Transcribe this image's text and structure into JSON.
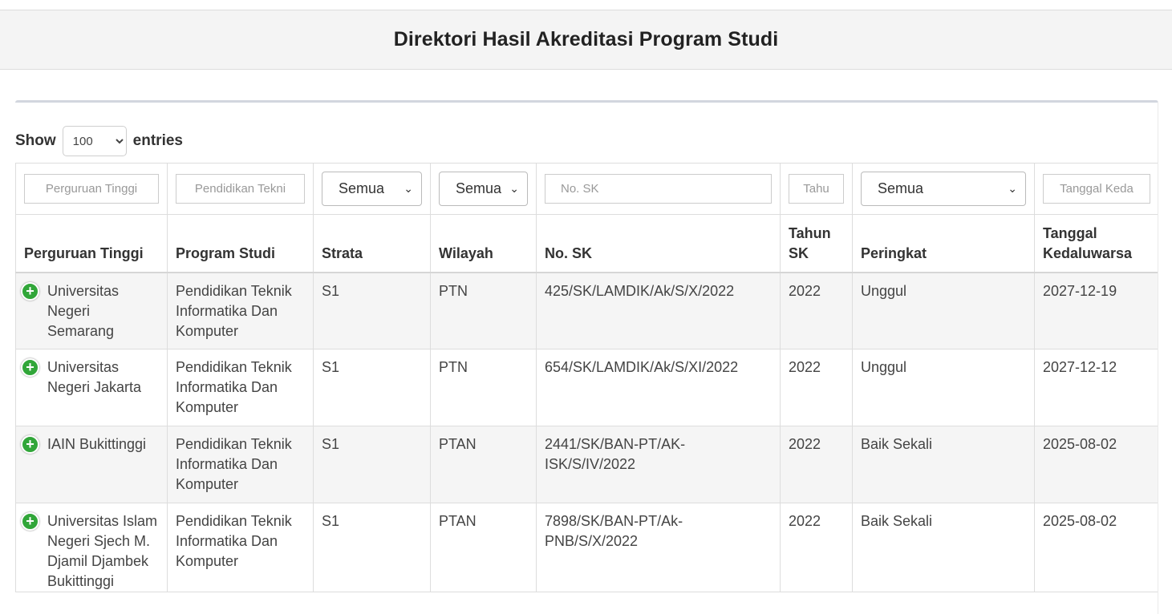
{
  "header": {
    "title": "Direktori Hasil Akreditasi Program Studi"
  },
  "length_menu": {
    "show_label": "Show",
    "selected": "100",
    "entries_label": "entries"
  },
  "filters": {
    "perguruan_tinggi_placeholder": "Perguruan Tinggi",
    "program_studi_placeholder": "Pendidikan Tekni",
    "strata_selected": "Semua",
    "wilayah_selected": "Semua",
    "no_sk_placeholder": "No. SK",
    "tahun_sk_placeholder": "Tahu",
    "peringkat_selected": "Semua",
    "tanggal_placeholder": "Tanggal Keda"
  },
  "columns": {
    "perguruan_tinggi": "Perguruan Tinggi",
    "program_studi": "Program Studi",
    "strata": "Strata",
    "wilayah": "Wilayah",
    "no_sk": "No. SK",
    "tahun_sk": "Tahun SK",
    "peringkat": "Peringkat",
    "tanggal": "Tanggal Kedaluwarsa"
  },
  "rows": [
    {
      "perguruan_tinggi": "Universitas Negeri Semarang",
      "program_studi": "Pendidikan Teknik Informatika Dan Komputer",
      "strata": "S1",
      "wilayah": "PTN",
      "no_sk": "425/SK/LAMDIK/Ak/S/X/2022",
      "tahun_sk": "2022",
      "peringkat": "Unggul",
      "tanggal": "2027-12-19"
    },
    {
      "perguruan_tinggi": "Universitas Negeri Jakarta",
      "program_studi": "Pendidikan Teknik Informatika Dan Komputer",
      "strata": "S1",
      "wilayah": "PTN",
      "no_sk": "654/SK/LAMDIK/Ak/S/XI/2022",
      "tahun_sk": "2022",
      "peringkat": "Unggul",
      "tanggal": "2027-12-12"
    },
    {
      "perguruan_tinggi": "IAIN Bukittinggi",
      "program_studi": "Pendidikan Teknik Informatika Dan Komputer",
      "strata": "S1",
      "wilayah": "PTAN",
      "no_sk": "2441/SK/BAN-PT/AK-ISK/S/IV/2022",
      "tahun_sk": "2022",
      "peringkat": "Baik Sekali",
      "tanggal": "2025-08-02"
    },
    {
      "perguruan_tinggi": "Universitas Islam Negeri Sjech M. Djamil Djambek Bukittinggi",
      "program_studi": "Pendidikan Teknik Informatika Dan Komputer",
      "strata": "S1",
      "wilayah": "PTAN",
      "no_sk": "7898/SK/BAN-PT/Ak-PNB/S/X/2022",
      "tahun_sk": "2022",
      "peringkat": "Baik Sekali",
      "tanggal": "2025-08-02"
    }
  ]
}
